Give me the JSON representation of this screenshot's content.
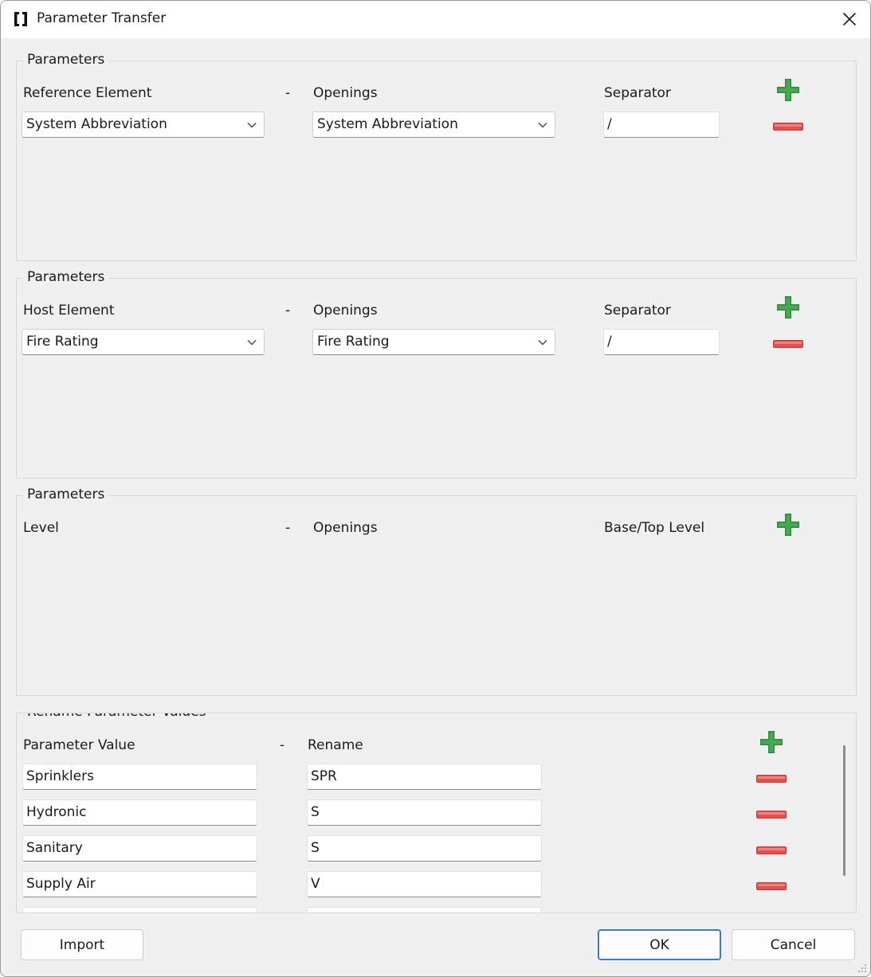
{
  "window": {
    "title": "Parameter Transfer"
  },
  "group1": {
    "legend": "Parameters",
    "col1_label": "Reference Element",
    "dash": "-",
    "col2_label": "Openings",
    "col3_label": "Separator",
    "combo1_value": "System Abbreviation",
    "combo2_value": "System Abbreviation",
    "separator_value": "/"
  },
  "group2": {
    "legend": "Parameters",
    "col1_label": "Host Element",
    "dash": "-",
    "col2_label": "Openings",
    "col3_label": "Separator",
    "combo1_value": "Fire Rating",
    "combo2_value": "Fire Rating",
    "separator_value": "/"
  },
  "group3": {
    "legend": "Parameters",
    "col1_label": "Level",
    "dash": "-",
    "col2_label": "Openings",
    "col3_label": "Base/Top Level"
  },
  "group4": {
    "legend": "Rename Parameter Values",
    "col1_label": "Parameter Value",
    "dash": "-",
    "col2_label": "Rename",
    "rows": [
      {
        "value": "Sprinklers",
        "rename": "SPR"
      },
      {
        "value": "Hydronic",
        "rename": "S"
      },
      {
        "value": "Sanitary",
        "rename": "S"
      },
      {
        "value": "Supply Air",
        "rename": "V"
      }
    ]
  },
  "buttons": {
    "import": "Import",
    "ok": "OK",
    "cancel": "Cancel"
  },
  "colors": {
    "plus": "#2e8b3e",
    "minus": "#e05050",
    "default_border": "#3d7ac7"
  },
  "icons": {
    "app": "bracket-icon",
    "close": "close-icon",
    "add": "plus-icon",
    "remove": "minus-icon",
    "dropdown": "chevron-down-icon",
    "resize": "resize-grip-icon"
  }
}
